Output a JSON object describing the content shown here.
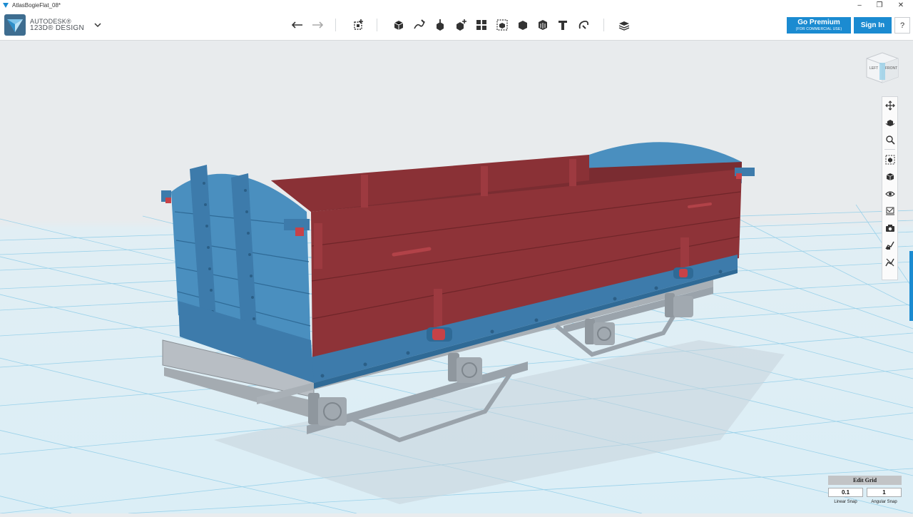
{
  "window": {
    "title": "AtlasBogieFlat_08*",
    "minimize": "‒",
    "maximize": "❐",
    "close": "✕"
  },
  "brand": {
    "line1": "AUTODESK®",
    "line2": "123D® DESIGN"
  },
  "toolbar": {
    "tools": [
      "undo-icon",
      "redo-icon",
      "transform-icon",
      "primitives-icon",
      "sketch-icon",
      "construct-icon",
      "modify-icon",
      "pattern-icon",
      "grouping-icon",
      "combine-icon",
      "measure-icon",
      "text-icon",
      "snap-icon",
      "materials-icon"
    ]
  },
  "account": {
    "premium_label": "Go Premium",
    "premium_sub": "(FOR COMMERCIAL USE)",
    "signin_label": "Sign In",
    "help_label": "?"
  },
  "viewcube": {
    "left_face": "LEFT",
    "front_face": "FRONT"
  },
  "navbar": {
    "items": [
      "pan-icon",
      "orbit-icon",
      "zoom-icon",
      "fit-icon",
      "view-icon",
      "visibility-icon",
      "materials-outline-icon",
      "screenshot-icon",
      "sketch-visible-icon",
      "sketch-hide-icon"
    ]
  },
  "grid": {
    "title": "Edit Grid",
    "linear_value": "0.1",
    "angular_value": "1",
    "linear_label": "Linear Snap",
    "angular_label": "Angular Snap"
  },
  "colors": {
    "accent": "#1b8bd1",
    "wagon_body": "#8e3338",
    "wagon_ends": "#4a8fbf",
    "chassis": "#9aa3ab",
    "grid": "#8fcde8"
  }
}
